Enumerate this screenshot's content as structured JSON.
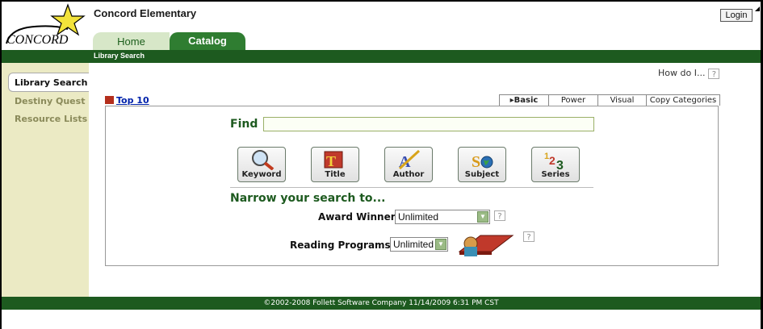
{
  "header": {
    "logo_text": "CONCORD",
    "school_name": "Concord Elementary",
    "login_label": "Login"
  },
  "main_tabs": [
    {
      "label": "Home",
      "active": false
    },
    {
      "label": "Catalog",
      "active": true
    }
  ],
  "subnav": {
    "label": "Library Search"
  },
  "sidebar": {
    "items": [
      {
        "label": "Library Search",
        "active": true
      },
      {
        "label": "Destiny Quest",
        "active": false
      },
      {
        "label": "Resource Lists",
        "active": false
      }
    ]
  },
  "help": {
    "how_do_i": "How do I...",
    "icon": "?"
  },
  "top10": {
    "label": "Top 10"
  },
  "search_tabs": [
    {
      "label": "▸Basic",
      "active": true
    },
    {
      "label": "Power",
      "active": false
    },
    {
      "label": "Visual",
      "active": false
    },
    {
      "label": "Copy Categories",
      "active": false
    }
  ],
  "find": {
    "label": "Find",
    "value": ""
  },
  "search_buttons": [
    {
      "label": "Keyword",
      "icon": "magnifier-icon"
    },
    {
      "label": "Title",
      "icon": "title-book-icon"
    },
    {
      "label": "Author",
      "icon": "author-pen-icon"
    },
    {
      "label": "Subject",
      "icon": "subject-globe-icon"
    },
    {
      "label": "Series",
      "icon": "series-123-icon"
    }
  ],
  "narrow": {
    "heading": "Narrow your search to...",
    "award_label": "Award Winner",
    "award_value": "Unlimited",
    "reading_label": "Reading Programs",
    "reading_value": "Unlimited"
  },
  "footer": {
    "text": "©2002-2008  Follett Software Company    11/14/2009 6:31 PM CST"
  },
  "colors": {
    "dark_green": "#1d5a1f",
    "tab_green": "#2f7d31",
    "sidebar_bg": "#ebeac4",
    "link_blue": "#0022aa"
  }
}
